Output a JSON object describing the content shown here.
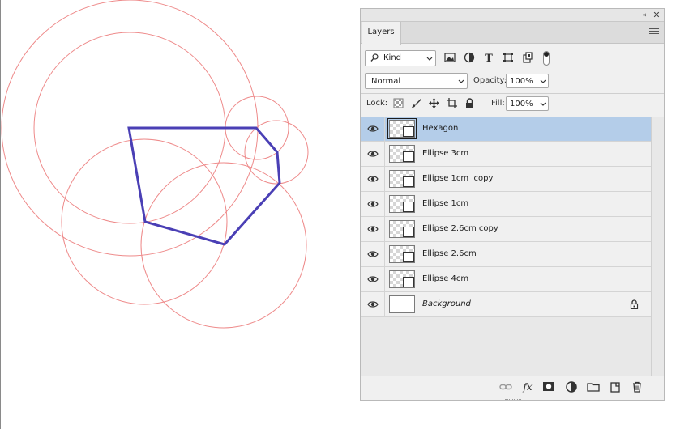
{
  "panel": {
    "collapse_icon": "«",
    "close_icon": "✕",
    "tab_label": "Layers",
    "filter": {
      "kind_label": "Kind"
    },
    "blend": {
      "mode": "Normal",
      "opacity_label": "Opacity:",
      "opacity_value": "100%"
    },
    "lock": {
      "label": "Lock:",
      "fill_label": "Fill:",
      "fill_value": "100%"
    },
    "layers": [
      {
        "name": "Hexagon",
        "selected": true,
        "type": "shape"
      },
      {
        "name": "Ellipse 3cm",
        "selected": false,
        "type": "shape"
      },
      {
        "name": "Ellipse 1cm  copy",
        "selected": false,
        "type": "shape"
      },
      {
        "name": "Ellipse 1cm",
        "selected": false,
        "type": "shape"
      },
      {
        "name": "Ellipse 2.6cm copy",
        "selected": false,
        "type": "shape"
      },
      {
        "name": "Ellipse 2.6cm",
        "selected": false,
        "type": "shape"
      },
      {
        "name": "Ellipse 4cm",
        "selected": false,
        "type": "shape"
      },
      {
        "name": "Background",
        "selected": false,
        "type": "background",
        "locked": true
      }
    ],
    "footer_icons": [
      "link-layers-icon",
      "fx-icon",
      "mask-icon",
      "adjustment-icon",
      "group-folder-icon",
      "new-layer-icon",
      "trash-icon"
    ],
    "fx_label": "fx"
  },
  "canvas": {
    "circle_color": "#ee8a8a",
    "polygon_color": "#4a3fb5"
  },
  "colors": {
    "selection": "#b4cde9",
    "panel_bg": "#f0f0f0"
  }
}
